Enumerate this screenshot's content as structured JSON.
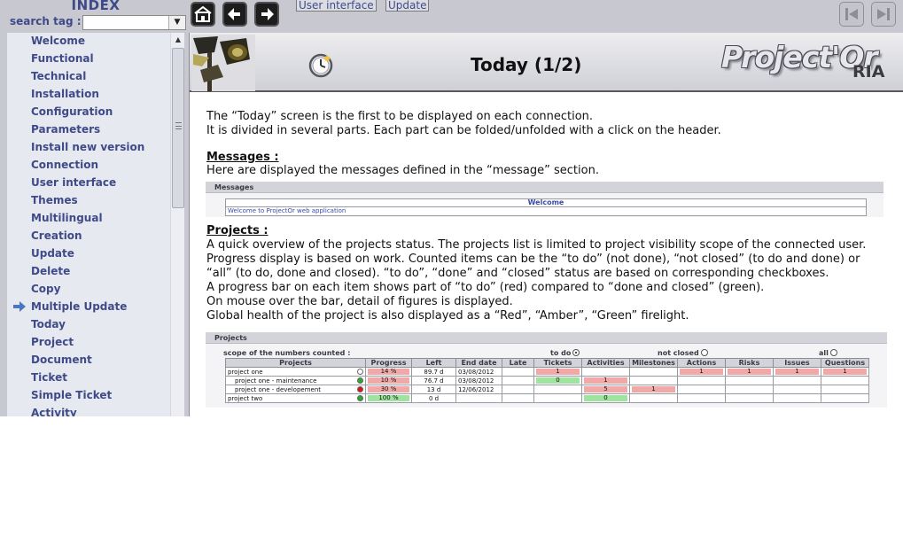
{
  "index": {
    "title": "INDEX",
    "search_label": "search tag :",
    "search_value": "",
    "dropdown_glyph": "▼",
    "items": [
      {
        "label": "Welcome",
        "active": false
      },
      {
        "label": "Functional",
        "active": false
      },
      {
        "label": "Technical",
        "active": false
      },
      {
        "label": "Installation",
        "active": false
      },
      {
        "label": "Configuration",
        "active": false
      },
      {
        "label": "Parameters",
        "active": false
      },
      {
        "label": "Install new version",
        "active": false
      },
      {
        "label": "Connection",
        "active": false
      },
      {
        "label": "User interface",
        "active": false
      },
      {
        "label": "Themes",
        "active": false
      },
      {
        "label": "Multilingual",
        "active": false
      },
      {
        "label": "Creation",
        "active": false
      },
      {
        "label": "Update",
        "active": false
      },
      {
        "label": "Delete",
        "active": false
      },
      {
        "label": "Copy",
        "active": false
      },
      {
        "label": "Multiple Update",
        "active": true
      },
      {
        "label": "Today",
        "active": false
      },
      {
        "label": "Project",
        "active": false
      },
      {
        "label": "Document",
        "active": false
      },
      {
        "label": "Ticket",
        "active": false
      },
      {
        "label": "Simple Ticket",
        "active": false
      },
      {
        "label": "Activity",
        "active": false
      }
    ]
  },
  "toolbar": {
    "breadcrumbs": [
      "User interface",
      "Update"
    ],
    "home_icon": "home-icon",
    "back_icon": "back-arrow-icon",
    "forward_icon": "forward-arrow-icon",
    "first_icon": "first-page-icon",
    "last_icon": "last-page-icon"
  },
  "page": {
    "heading": "Today (1/2)",
    "brand": "Project'Or",
    "brand_suffix": "RIA",
    "intro": [
      "The “Today” screen is the first to be displayed on each connection.",
      "It is divided in several parts. Each part can be folded/unfolded with a click on the header."
    ],
    "messages": {
      "heading": "Messages :",
      "text": "Here are displayed the messages defined in the “message” section.",
      "shot_title": "Messages",
      "shot_column": "Welcome",
      "shot_row": "Welcome to ProjectOr web application"
    },
    "projects": {
      "heading": "Projects :",
      "lines": [
        "A quick overview of the projects status. The projects list is limited to project visibility scope of the connected user.",
        "Progress display is based on work. Counted items can be the “to do” (not done), “not closed” (to do and done) or",
        "“all” (to do, done and closed). “to do”, “done” and “closed” status are based on corresponding checkboxes.",
        "A progress bar on each item shows part of “to do” (red) compared to “done and closed” (green).",
        "On mouse over the bar, detail of figures is displayed.",
        "Global health of the project is also displayed as a “Red”, “Amber”, “Green” firelight."
      ],
      "shot_title": "Projects",
      "scope_label": "scope of the numbers counted :",
      "scope_options": [
        {
          "label": "to do",
          "selected": true
        },
        {
          "label": "not closed",
          "selected": false
        },
        {
          "label": "all",
          "selected": false
        }
      ],
      "columns": [
        "Projects",
        "Progress",
        "Left",
        "End date",
        "Late",
        "Tickets",
        "Activities",
        "Milestones",
        "Actions",
        "Risks",
        "Issues",
        "Questions"
      ],
      "rows": [
        {
          "name": "project one",
          "health": "none",
          "progress": "14 %",
          "progress_color": "red",
          "left": "89.7 d",
          "end": "03/08/2012",
          "late": "",
          "tickets": "1",
          "tickets_color": "red",
          "activities": "",
          "activities_color": "",
          "milestones": "",
          "milestones_color": "",
          "actions": "1",
          "risks": "1",
          "issues": "1",
          "questions": "1"
        },
        {
          "name": "project one - maintenance",
          "health": "green",
          "progress": "10 %",
          "progress_color": "red",
          "left": "76.7 d",
          "end": "03/08/2012",
          "late": "",
          "tickets": "0",
          "tickets_color": "green",
          "activities": "1",
          "activities_color": "red",
          "milestones": "",
          "milestones_color": "",
          "actions": "",
          "risks": "",
          "issues": "",
          "questions": ""
        },
        {
          "name": "project one - developement",
          "health": "red",
          "progress": "30 %",
          "progress_color": "red",
          "left": "13 d",
          "end": "12/06/2012",
          "late": "",
          "tickets": "",
          "tickets_color": "",
          "activities": "5",
          "activities_color": "red",
          "milestones": "1",
          "milestones_color": "red",
          "actions": "",
          "risks": "",
          "issues": "",
          "questions": ""
        },
        {
          "name": "project two",
          "health": "green",
          "progress": "100 %",
          "progress_color": "green",
          "left": "0 d",
          "end": "",
          "late": "",
          "tickets": "",
          "tickets_color": "",
          "activities": "0",
          "activities_color": "green",
          "milestones": "",
          "milestones_color": "",
          "actions": "",
          "risks": "",
          "issues": "",
          "questions": ""
        }
      ]
    }
  },
  "colors": {
    "app_background": "#c8c9d0",
    "nav_background": "#e7e9f0",
    "nav_text": "#3f4a88",
    "todo_red": "#f3a8a8",
    "done_green": "#9ee39e",
    "health_red": "#e01010",
    "health_green": "#22b022"
  }
}
